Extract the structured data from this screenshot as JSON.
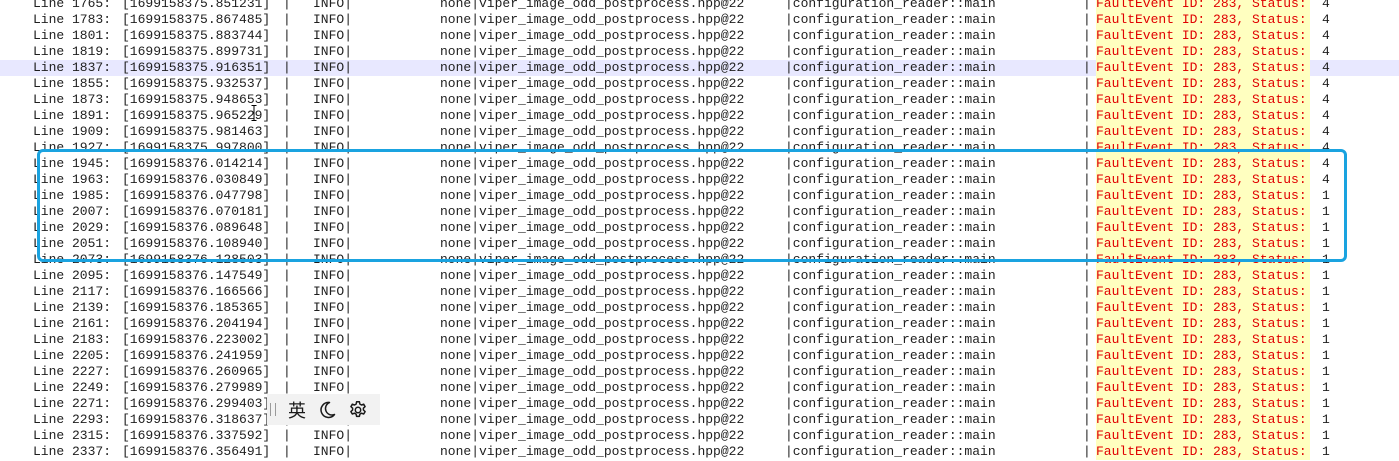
{
  "log_rows": [
    {
      "line": "Line 1765:",
      "ts": "[1699158375.851231]",
      "level": "INFO|",
      "file": "none|viper_image_odd_postprocess.hpp@22",
      "func": "|configuration_reader::main",
      "msg": "FaultEvent ID: 283, Status:",
      "status": "4"
    },
    {
      "line": "Line 1783:",
      "ts": "[1699158375.867485]",
      "level": "INFO|",
      "file": "none|viper_image_odd_postprocess.hpp@22",
      "func": "|configuration_reader::main",
      "msg": "FaultEvent ID: 283, Status:",
      "status": "4"
    },
    {
      "line": "Line 1801:",
      "ts": "[1699158375.883744]",
      "level": "INFO|",
      "file": "none|viper_image_odd_postprocess.hpp@22",
      "func": "|configuration_reader::main",
      "msg": "FaultEvent ID: 283, Status:",
      "status": "4"
    },
    {
      "line": "Line 1819:",
      "ts": "[1699158375.899731]",
      "level": "INFO|",
      "file": "none|viper_image_odd_postprocess.hpp@22",
      "func": "|configuration_reader::main",
      "msg": "FaultEvent ID: 283, Status:",
      "status": "4"
    },
    {
      "line": "Line 1837:",
      "ts": "[1699158375.916351]",
      "level": "INFO|",
      "file": "none|viper_image_odd_postprocess.hpp@22",
      "func": "|configuration_reader::main",
      "msg": "FaultEvent ID: 283, Status:",
      "status": "4",
      "current": true
    },
    {
      "line": "Line 1855:",
      "ts": "[1699158375.932537]",
      "level": "INFO|",
      "file": "none|viper_image_odd_postprocess.hpp@22",
      "func": "|configuration_reader::main",
      "msg": "FaultEvent ID: 283, Status:",
      "status": "4"
    },
    {
      "line": "Line 1873:",
      "ts": "[1699158375.948653]",
      "level": "INFO|",
      "file": "none|viper_image_odd_postprocess.hpp@22",
      "func": "|configuration_reader::main",
      "msg": "FaultEvent ID: 283, Status:",
      "status": "4"
    },
    {
      "line": "Line 1891:",
      "ts": "[1699158375.965229]",
      "level": "INFO|",
      "file": "none|viper_image_odd_postprocess.hpp@22",
      "func": "|configuration_reader::main",
      "msg": "FaultEvent ID: 283, Status:",
      "status": "4"
    },
    {
      "line": "Line 1909:",
      "ts": "[1699158375.981463]",
      "level": "INFO|",
      "file": "none|viper_image_odd_postprocess.hpp@22",
      "func": "|configuration_reader::main",
      "msg": "FaultEvent ID: 283, Status:",
      "status": "4"
    },
    {
      "line": "Line 1927:",
      "ts": "[1699158375.997800]",
      "level": "INFO|",
      "file": "none|viper_image_odd_postprocess.hpp@22",
      "func": "|configuration_reader::main",
      "msg": "FaultEvent ID: 283, Status:",
      "status": "4"
    },
    {
      "line": "Line 1945:",
      "ts": "[1699158376.014214]",
      "level": "INFO|",
      "file": "none|viper_image_odd_postprocess.hpp@22",
      "func": "|configuration_reader::main",
      "msg": "FaultEvent ID: 283, Status:",
      "status": "4"
    },
    {
      "line": "Line 1963:",
      "ts": "[1699158376.030849]",
      "level": "INFO|",
      "file": "none|viper_image_odd_postprocess.hpp@22",
      "func": "|configuration_reader::main",
      "msg": "FaultEvent ID: 283, Status:",
      "status": "4"
    },
    {
      "line": "Line 1985:",
      "ts": "[1699158376.047798]",
      "level": "INFO|",
      "file": "none|viper_image_odd_postprocess.hpp@22",
      "func": "|configuration_reader::main",
      "msg": "FaultEvent ID: 283, Status:",
      "status": "1"
    },
    {
      "line": "Line 2007:",
      "ts": "[1699158376.070181]",
      "level": "INFO|",
      "file": "none|viper_image_odd_postprocess.hpp@22",
      "func": "|configuration_reader::main",
      "msg": "FaultEvent ID: 283, Status:",
      "status": "1"
    },
    {
      "line": "Line 2029:",
      "ts": "[1699158376.089648]",
      "level": "INFO|",
      "file": "none|viper_image_odd_postprocess.hpp@22",
      "func": "|configuration_reader::main",
      "msg": "FaultEvent ID: 283, Status:",
      "status": "1"
    },
    {
      "line": "Line 2051:",
      "ts": "[1699158376.108940]",
      "level": "INFO|",
      "file": "none|viper_image_odd_postprocess.hpp@22",
      "func": "|configuration_reader::main",
      "msg": "FaultEvent ID: 283, Status:",
      "status": "1"
    },
    {
      "line": "Line 2073:",
      "ts": "[1699158376.128503]",
      "level": "INFO|",
      "file": "none|viper_image_odd_postprocess.hpp@22",
      "func": "|configuration_reader::main",
      "msg": "FaultEvent ID: 283, Status:",
      "status": "1"
    },
    {
      "line": "Line 2095:",
      "ts": "[1699158376.147549]",
      "level": "INFO|",
      "file": "none|viper_image_odd_postprocess.hpp@22",
      "func": "|configuration_reader::main",
      "msg": "FaultEvent ID: 283, Status:",
      "status": "1"
    },
    {
      "line": "Line 2117:",
      "ts": "[1699158376.166566]",
      "level": "INFO|",
      "file": "none|viper_image_odd_postprocess.hpp@22",
      "func": "|configuration_reader::main",
      "msg": "FaultEvent ID: 283, Status:",
      "status": "1"
    },
    {
      "line": "Line 2139:",
      "ts": "[1699158376.185365]",
      "level": "INFO|",
      "file": "none|viper_image_odd_postprocess.hpp@22",
      "func": "|configuration_reader::main",
      "msg": "FaultEvent ID: 283, Status:",
      "status": "1"
    },
    {
      "line": "Line 2161:",
      "ts": "[1699158376.204194]",
      "level": "INFO|",
      "file": "none|viper_image_odd_postprocess.hpp@22",
      "func": "|configuration_reader::main",
      "msg": "FaultEvent ID: 283, Status:",
      "status": "1"
    },
    {
      "line": "Line 2183:",
      "ts": "[1699158376.223002]",
      "level": "INFO|",
      "file": "none|viper_image_odd_postprocess.hpp@22",
      "func": "|configuration_reader::main",
      "msg": "FaultEvent ID: 283, Status:",
      "status": "1"
    },
    {
      "line": "Line 2205:",
      "ts": "[1699158376.241959]",
      "level": "INFO|",
      "file": "none|viper_image_odd_postprocess.hpp@22",
      "func": "|configuration_reader::main",
      "msg": "FaultEvent ID: 283, Status:",
      "status": "1"
    },
    {
      "line": "Line 2227:",
      "ts": "[1699158376.260965]",
      "level": "INFO|",
      "file": "none|viper_image_odd_postprocess.hpp@22",
      "func": "|configuration_reader::main",
      "msg": "FaultEvent ID: 283, Status:",
      "status": "1"
    },
    {
      "line": "Line 2249:",
      "ts": "[1699158376.279989]",
      "level": "INFO|",
      "file": "none|viper_image_odd_postprocess.hpp@22",
      "func": "|configuration_reader::main",
      "msg": "FaultEvent ID: 283, Status:",
      "status": "1"
    },
    {
      "line": "Line 2271:",
      "ts": "[1699158376.299403]",
      "level": "INFO|",
      "file": "none|viper_image_odd_postprocess.hpp@22",
      "func": "|configuration_reader::main",
      "msg": "FaultEvent ID: 283, Status:",
      "status": "1"
    },
    {
      "line": "Line 2293:",
      "ts": "[1699158376.318637]",
      "level": "INFO|",
      "file": "none|viper_image_odd_postprocess.hpp@22",
      "func": "|configuration_reader::main",
      "msg": "FaultEvent ID: 283, Status:",
      "status": "1"
    },
    {
      "line": "Line 2315:",
      "ts": "[1699158376.337592]",
      "level": "INFO|",
      "file": "none|viper_image_odd_postprocess.hpp@22",
      "func": "|configuration_reader::main",
      "msg": "FaultEvent ID: 283, Status:",
      "status": "1"
    },
    {
      "line": "Line 2337:",
      "ts": "[1699158376.356491]",
      "level": "INFO|",
      "file": "none|viper_image_odd_postprocess.hpp@22",
      "func": "|configuration_reader::main",
      "msg": "FaultEvent ID: 283, Status:",
      "status": "1"
    }
  ],
  "separator": "|",
  "ime_toolbar": {
    "language_label": "英",
    "icons": [
      "grip-icon",
      "moon-icon",
      "gear-icon"
    ]
  },
  "colors": {
    "highlight_box": "#1aa3e0",
    "match_background": "#ffffc0",
    "match_text": "#e00000",
    "current_line": "#e8e8ff"
  }
}
